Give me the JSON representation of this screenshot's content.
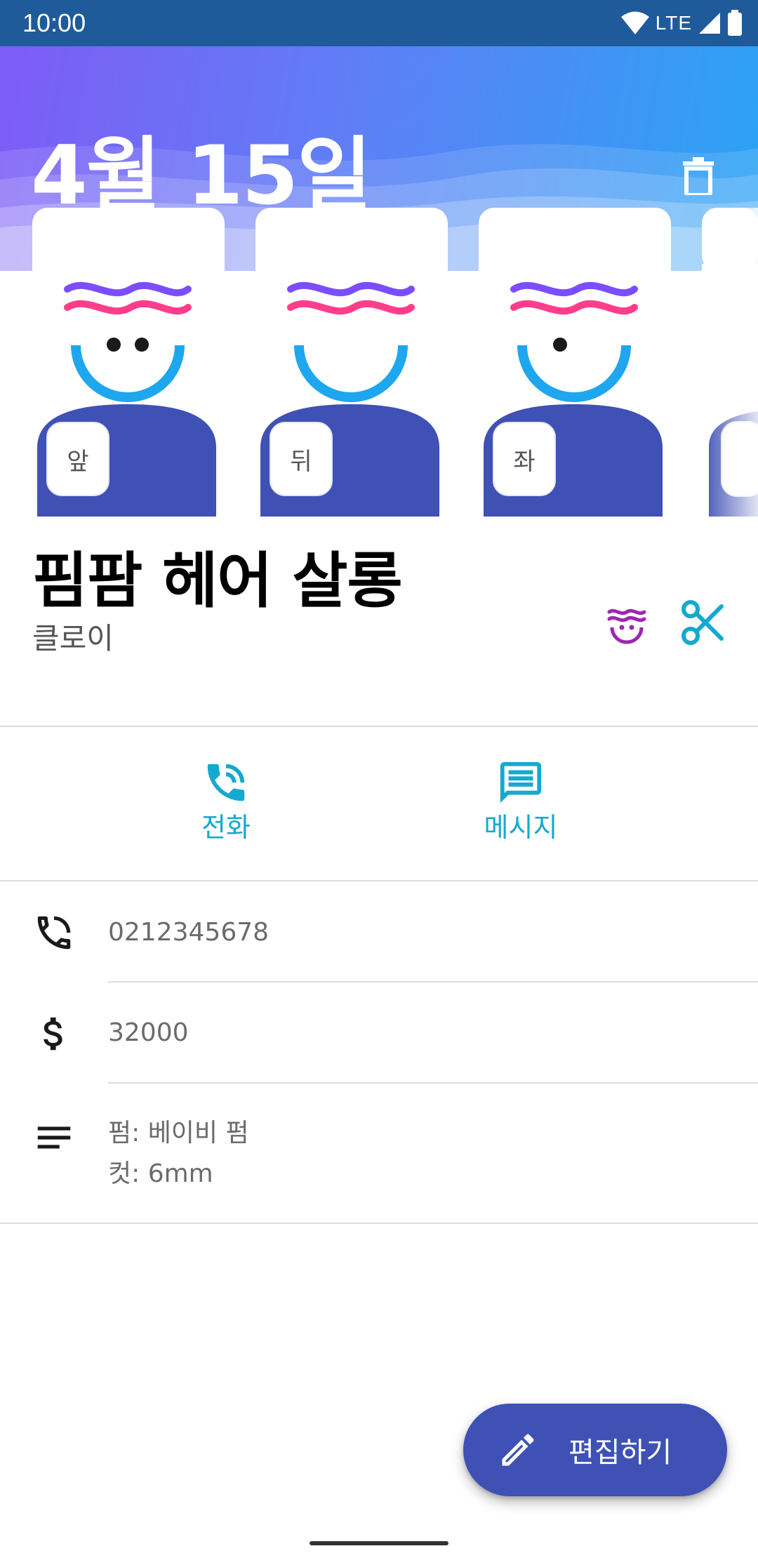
{
  "status_bar": {
    "time": "10:00",
    "network": "LTE"
  },
  "header": {
    "date": "4월 15일",
    "delete_icon": "trash-icon"
  },
  "photos": [
    {
      "label": "앞"
    },
    {
      "label": "뒤"
    },
    {
      "label": "좌"
    }
  ],
  "salon": {
    "name": "핌팜 헤어 살롱",
    "stylist": "클로이"
  },
  "actions": {
    "call_label": "전화",
    "message_label": "메시지"
  },
  "details": {
    "phone": "0212345678",
    "price": "32000",
    "memo_line1": "펌: 베이비 펌",
    "memo_line2": "컷: 6mm"
  },
  "fab": {
    "label": "편집하기"
  },
  "colors": {
    "primary": "#3f51b5",
    "accent_cyan": "#15a9cf",
    "purple": "#9c27b0",
    "header_gradient_start": "#7e5cf6",
    "header_gradient_end": "#2aa4f4"
  }
}
